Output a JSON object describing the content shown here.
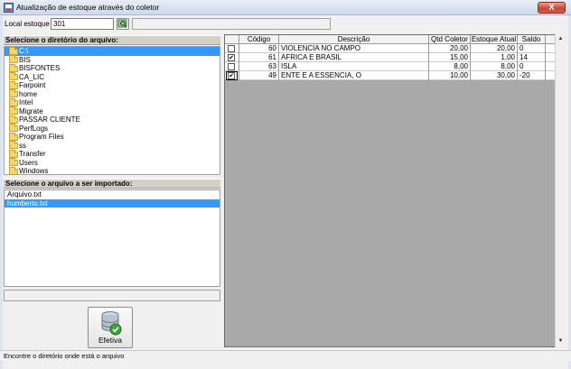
{
  "window": {
    "title": "Atualização de estoque através do coletor",
    "close_label": "X"
  },
  "local": {
    "label": "Local estoque",
    "value": "301"
  },
  "directory_panel": {
    "header": "Selecione o diretório do arquivo:",
    "items": [
      {
        "label": "C:\\",
        "selected": true
      },
      {
        "label": "BIS"
      },
      {
        "label": "BISFONTES"
      },
      {
        "label": "CA_LIC"
      },
      {
        "label": "Farpoint"
      },
      {
        "label": "home"
      },
      {
        "label": "Intel"
      },
      {
        "label": "Migrate"
      },
      {
        "label": "PASSAR CLIENTE"
      },
      {
        "label": "PerfLogs"
      },
      {
        "label": "Program Files"
      },
      {
        "label": "ss"
      },
      {
        "label": "Transfer"
      },
      {
        "label": "Users"
      },
      {
        "label": "Windows"
      }
    ]
  },
  "file_panel": {
    "header": "Selecione o arquivo a ser importado:",
    "items": [
      {
        "label": "Arquivo.txt"
      },
      {
        "label": "humberto.txt",
        "selected": true
      }
    ]
  },
  "action": {
    "label": "Efetiva"
  },
  "grid": {
    "columns": [
      "",
      "Código",
      "Descrição",
      "Qtd Coletor",
      "Estoque Atual",
      "Saldo"
    ],
    "rows": [
      {
        "checked": false,
        "codigo": "60",
        "descricao": "VIOLENCIA NO CAMPO",
        "qtd": "20,00",
        "estoque": "20,00",
        "saldo": "0"
      },
      {
        "checked": true,
        "codigo": "61",
        "descricao": "AFRICA E BRASIL",
        "qtd": "15,00",
        "estoque": "1,00",
        "saldo": "14"
      },
      {
        "checked": false,
        "codigo": "63",
        "descricao": "ISLA",
        "qtd": "8,00",
        "estoque": "8,00",
        "saldo": "0"
      },
      {
        "checked": true,
        "codigo": "49",
        "descricao": "ENTE E A ESSENCIA, O",
        "qtd": "10,00",
        "estoque": "30,00",
        "saldo": "-20"
      }
    ]
  },
  "statusbar": {
    "text": "Encontre o diretório onde está o arquivo"
  }
}
